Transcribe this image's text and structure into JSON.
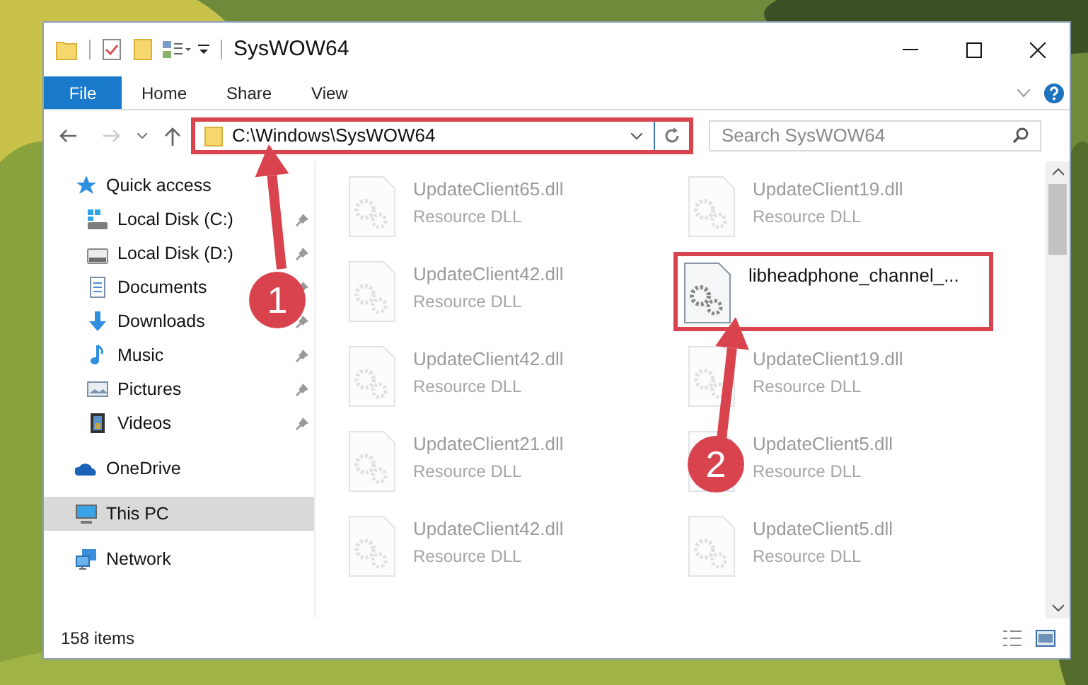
{
  "window": {
    "title": "SysWOW64"
  },
  "ribbon_tabs": [
    {
      "label": "File",
      "kind": "file"
    },
    {
      "label": "Home",
      "kind": "tab"
    },
    {
      "label": "Share",
      "kind": "tab"
    },
    {
      "label": "View",
      "kind": "tab"
    }
  ],
  "address_bar": {
    "path": "C:\\Windows\\SysWOW64",
    "highlighted": true
  },
  "search": {
    "placeholder": "Search SysWOW64"
  },
  "navigation": [
    {
      "label": "Quick access",
      "selected": false,
      "children": [
        {
          "label": "Local Disk (C:)",
          "pinned": true,
          "selected": false
        },
        {
          "label": "Local Disk (D:)",
          "pinned": true,
          "selected": false
        },
        {
          "label": "Documents",
          "pinned": true,
          "selected": false
        },
        {
          "label": "Downloads",
          "pinned": true,
          "selected": false
        },
        {
          "label": "Music",
          "pinned": true,
          "selected": false
        },
        {
          "label": "Pictures",
          "pinned": true,
          "selected": false
        },
        {
          "label": "Videos",
          "pinned": true,
          "selected": false
        }
      ]
    },
    {
      "label": "OneDrive",
      "selected": false
    },
    {
      "label": "This PC",
      "selected": true
    },
    {
      "label": "Network",
      "selected": false
    }
  ],
  "files": [
    {
      "name": "UpdateClient65.dll",
      "type": "Resource DLL",
      "blurred": true,
      "highlighted": false
    },
    {
      "name": "UpdateClient19.dll",
      "type": "Resource DLL",
      "blurred": true,
      "highlighted": false
    },
    {
      "name": "UpdateClient42.dll",
      "type": "Resource DLL",
      "blurred": true,
      "highlighted": false
    },
    {
      "name": "libheadphone_channel_...",
      "blurred": false,
      "highlighted": true
    },
    {
      "name": "UpdateClient42.dll",
      "type": "Resource DLL",
      "blurred": true,
      "highlighted": false
    },
    {
      "name": "UpdateClient19.dll",
      "type": "Resource DLL",
      "blurred": true,
      "highlighted": false
    },
    {
      "name": "UpdateClient21.dll",
      "type": "Resource DLL",
      "blurred": true,
      "highlighted": false
    },
    {
      "name": "UpdateClient5.dll",
      "type": "Resource DLL",
      "blurred": true,
      "highlighted": false
    },
    {
      "name": "UpdateClient42.dll",
      "type": "Resource DLL",
      "blurred": true,
      "highlighted": false
    },
    {
      "name": "UpdateClient5.dll",
      "type": "Resource DLL",
      "blurred": true,
      "highlighted": false
    }
  ],
  "annotations": [
    {
      "label": "1"
    },
    {
      "label": "2"
    }
  ],
  "status_bar": {
    "item_count": "158 items"
  }
}
